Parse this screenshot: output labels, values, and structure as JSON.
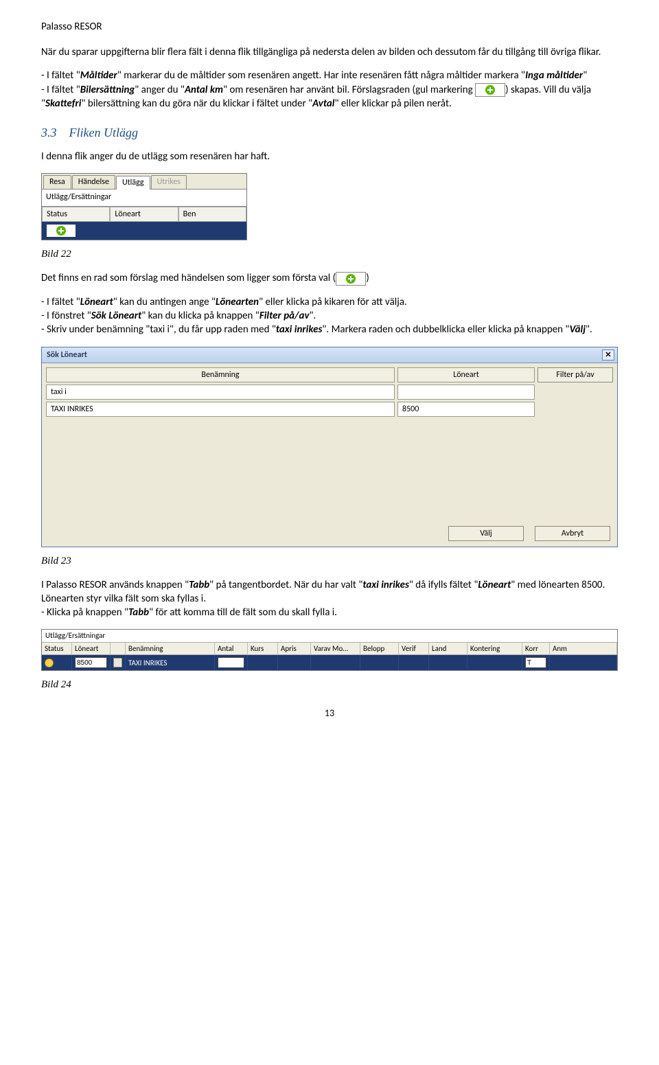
{
  "header": "Palasso RESOR",
  "p1": "När du sparar uppgifterna blir flera fält i denna flik tillgängliga på nedersta delen av bilden och dessutom får du tillgång till övriga flikar.",
  "p2_parts": {
    "a": "- I fältet \"",
    "b": "Måltider",
    "c": "\" markerar du de måltider som resenären angett. Har inte resenären fått några måltider markera \"",
    "d": "Inga måltider",
    "e": "\"",
    "f": "- I fältet \"",
    "g": "Bilersättning",
    "h": "\" anger du \"",
    "i": "Antal km",
    "j": "\" om resenären har använt bil. Förslagsraden (gul markering ",
    "k": ") skapas. Vill du välja \"",
    "l": "Skattefri",
    "m": "\" bilersättning kan du göra när du klickar i fältet under \"",
    "n": "Avtal",
    "o": "\" eller klickar på pilen neråt."
  },
  "section": {
    "num": "3.3",
    "title": "Fliken Utlägg"
  },
  "p3": "I denna flik anger du de utlägg som resenären har haft.",
  "fig1": {
    "tabs": [
      "Resa",
      "Händelse",
      "Utlägg",
      "Utrikes"
    ],
    "label": "Utlägg/Ersättningar",
    "cols": [
      "Status",
      "Löneart",
      "Ben"
    ]
  },
  "cap1": "Bild 22",
  "p4_parts": {
    "a": "Det finns en rad som förslag med händelsen som ligger som första val (",
    "b": ")"
  },
  "p5_parts": {
    "a": "- I fältet \"",
    "b": "Löneart",
    "c": "\" kan du antingen ange \"",
    "d": "Lönearten",
    "e": "\" eller klicka på kikaren för att välja.",
    "f": "- I fönstret \"",
    "g": "Sök Löneart",
    "h": "\" kan du klicka på knappen \"",
    "i": "Filter på/av",
    "j": "\".",
    "k": "- Skriv under benämning \"taxi i\", du får upp raden med \"",
    "l": "taxi inrikes",
    "m": "\". Markera raden och dubbelklicka eller klicka på knappen \"",
    "n": "Välj",
    "o": "\"."
  },
  "win": {
    "title": "Sök Löneart",
    "col_ben": "Benämning",
    "col_lon": "Löneart",
    "btn_filter": "Filter på/av",
    "row1_ben": "taxi i",
    "row2_ben": "TAXI INRIKES",
    "row2_lon": "8500",
    "btn_valj": "Välj",
    "btn_avbryt": "Avbryt"
  },
  "cap2": "Bild 23",
  "p6_parts": {
    "a": "I Palasso RESOR används knappen \"",
    "b": "Tabb",
    "c": "\" på tangentbordet. När du har valt \"",
    "d": "taxi inrikes",
    "e": "\" då ifylls fältet \"",
    "f": "Löneart",
    "g": "\" med lönearten 8500. Lönearten styr vilka fält som ska fyllas i.",
    "h": "- Klicka på knappen \"",
    "i": "Tabb",
    "j": "\" för att komma till de fält som du skall fylla i."
  },
  "strip": {
    "title": "Utlägg/Ersättningar",
    "cols": [
      "Status",
      "Löneart",
      "Benämning",
      "Antal",
      "Kurs",
      "Apris",
      "Varav Mo…",
      "Belopp",
      "Verif",
      "Land",
      "Kontering",
      "Korr",
      "Anm"
    ],
    "row": {
      "loneart": "8500",
      "ben": "TAXI INRIKES",
      "korr": "T"
    }
  },
  "cap3": "Bild 24",
  "page_number": "13"
}
